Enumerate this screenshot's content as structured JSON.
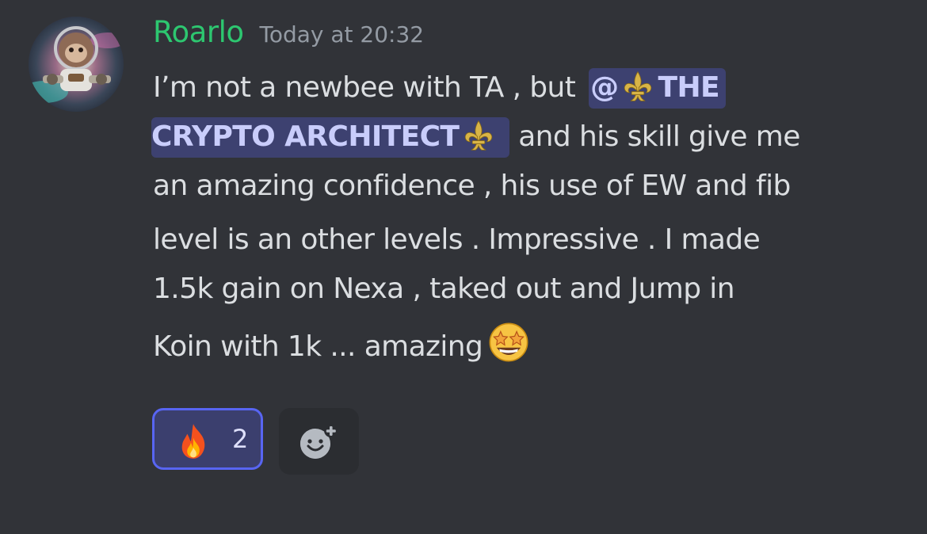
{
  "message": {
    "username": "Roarlo",
    "timestamp": "Today at 20:32",
    "username_color": "#2dc770",
    "avatar_icon": "astronaut-monkey-avatar",
    "lines": {
      "l1_text": "I’m not a newbee with TA , but ",
      "l1_mention": "THE",
      "l1_mention_prefix": "@",
      "l2_mention": "CRYPTO ARCHITECT",
      "l2_text": " and his skill give me",
      "l3_text": "an amazing confidence , his use of EW and fib",
      "l4_text": "level is an other levels . Impressive . I made",
      "l5_text": "1.5k gain on Nexa ,  taked out and  Jump in",
      "l6_text": "Koin with 1k ... amazing"
    },
    "mention_color": "#5865f2",
    "emoji_icons": [
      "fleur-de-lis-icon",
      "star-struck-emoji-icon"
    ]
  },
  "reactions": {
    "fire": {
      "icon": "fire-emoji-icon",
      "count": "2"
    },
    "add_reaction_icon": "add-reaction-icon"
  }
}
